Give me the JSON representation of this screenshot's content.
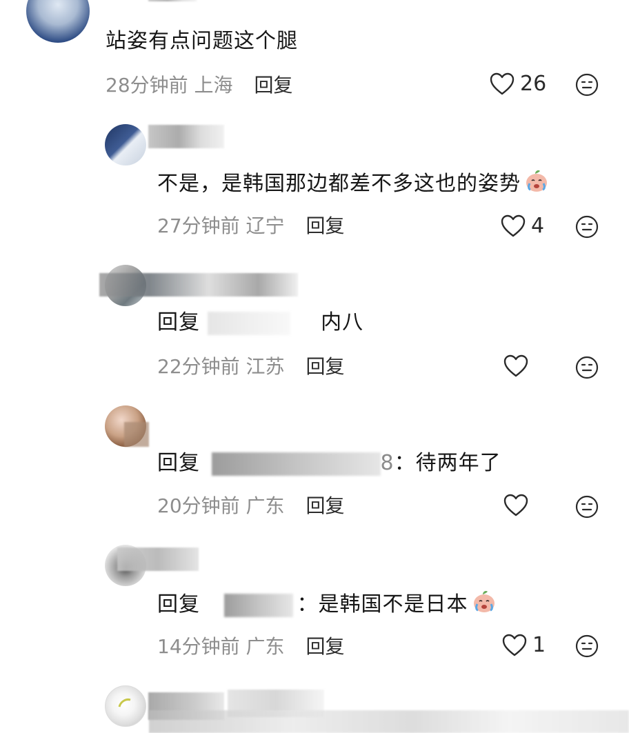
{
  "comments": [
    {
      "text": "站姿有点问题这个腿",
      "time": "28分钟前",
      "location": "上海",
      "reply_label": "回复",
      "likes": "26"
    },
    {
      "text": "不是，是韩国那边都差不多这也的姿势",
      "time": "27分钟前",
      "location": "辽宁",
      "reply_label": "回复",
      "likes": "4"
    },
    {
      "reply_prefix": "回复",
      "text": "内八",
      "time": "22分钟前",
      "location": "江苏",
      "reply_label": "回复",
      "likes": ""
    },
    {
      "reply_prefix": "回复",
      "visible_name_fragment": "8",
      "text": "：待两年了",
      "time": "20分钟前",
      "location": "广东",
      "reply_label": "回复",
      "likes": ""
    },
    {
      "reply_prefix": "回复",
      "text": "：是韩国不是日本",
      "time": "14分钟前",
      "location": "广东",
      "reply_label": "回复",
      "likes": "1"
    }
  ],
  "icons": {
    "like": "heart-outline-icon",
    "react": "neutral-face-icon",
    "emoji": "crying-peach-emoji-icon"
  },
  "colors": {
    "text": "#161616",
    "meta": "#8d8d8d",
    "reply": "#2c2c2c"
  }
}
